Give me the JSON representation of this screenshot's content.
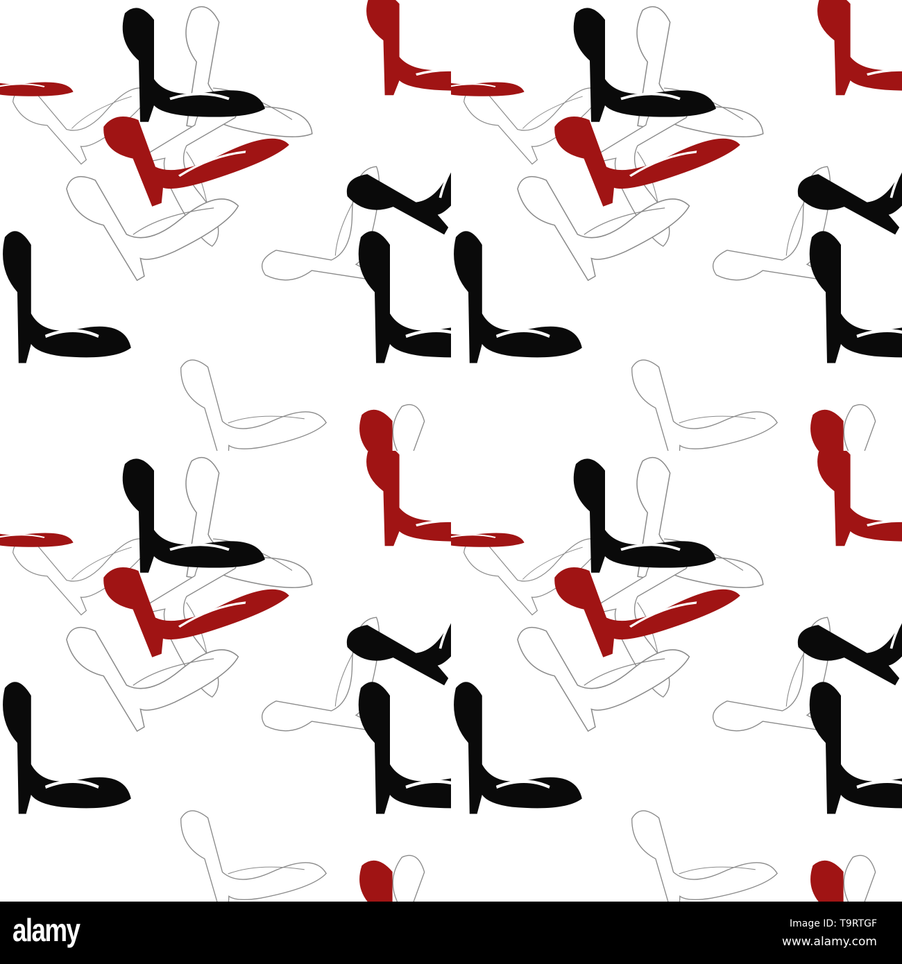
{
  "pattern": {
    "subject": "high-heel shoes",
    "colors": {
      "red": "#a01414",
      "black": "#0a0a0a",
      "outline": "#8a8a8a",
      "background": "#ffffff"
    }
  },
  "footer": {
    "logo": "alamy",
    "image_id": "Image ID: T9RTGF",
    "website": "www.alamy.com"
  }
}
